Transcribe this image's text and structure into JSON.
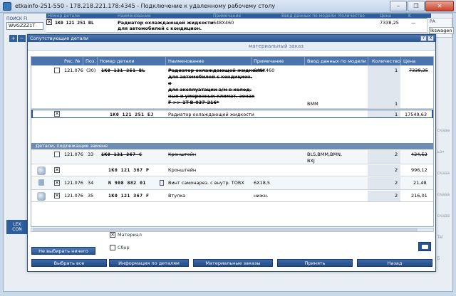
{
  "window": {
    "title": "etkainfo-251-550 - 178.218.221.178:4345 - Подключение к удаленному рабочему столу",
    "buttons": {
      "minimize": "–",
      "restore": "❐",
      "close": "✕"
    }
  },
  "background": {
    "search_label": "ПОИСК FI",
    "search_value": "WVGZZZ1T",
    "header_cols": [
      "Номер детали",
      "Наименование",
      "Примечание",
      "Ввод данных по модели",
      "Количество",
      "Цена",
      "K"
    ],
    "row": {
      "part": "1K0 121 251 BL",
      "name": "Радиатор охлаждающей жидкости",
      "name2": "для автомобилей с кондицион.",
      "note": "648X460",
      "price": "7338,25",
      "k": "—"
    },
    "right_tab_label": "РА",
    "right_tab_value": "lkswagen",
    "left_strip": "LEX\nCON",
    "right_labels": [
      "сказа",
      "ьз»",
      "сказа",
      "сказа",
      "сказа",
      "Tal",
      "Б"
    ]
  },
  "dialog": {
    "title": "Сопутствующие детали",
    "title_btns": [
      "?",
      "X"
    ],
    "subtitle": "материальный заказ",
    "columns": [
      "Рис. №",
      "Поз.",
      "Номер детали",
      "Наименование",
      "Примечание",
      "Ввод данных по модели",
      "Количество",
      "Цена"
    ],
    "rows": [
      {
        "checked": false,
        "fig": "121.076",
        "pos": "(30)",
        "part": "1K0 121 251 BL",
        "name_lines": [
          "Радиатор охлаждающей жидкости",
          "для автомобилей с кондицион.",
          "и",
          "для эксплуатации а/м в холод.",
          "ных и умеренных климат. зонах",
          "F          >> 1T-B-037-216*"
        ],
        "note": "648X460",
        "model": "BMM",
        "qty": "1",
        "qty2": "1",
        "price": "7338,25"
      },
      {
        "checked": true,
        "part": "1K0 121 251 EJ",
        "name": "Радиатор охлаждающей жидкости",
        "qty": "1",
        "price": "17549,63"
      }
    ],
    "section": "Детали, подлежащие замене",
    "replace_rows": [
      {
        "checked": false,
        "fig": "121.076",
        "pos": "33",
        "part": "1K0 121 367 C",
        "name": "Кронштейн",
        "model": "BLS,BMM,BMN,",
        "model2": "BXJ",
        "qty": "2",
        "price": "424,52"
      },
      {
        "checked": true,
        "part": "1K0 121 367 P",
        "name": "Кронштейн",
        "qty": "2",
        "price": "996,12"
      },
      {
        "checked": true,
        "fig": "121.076",
        "pos": "34",
        "part": "N    908 882 01",
        "name": "Винт самонарез. с внутр. TORX",
        "note": "6X18,5",
        "qty": "2",
        "price": "21,48"
      },
      {
        "checked": true,
        "fig": "121.076",
        "pos": "35",
        "part": "1K0 121 367 F",
        "name": "Втулка",
        "note": "нижн.",
        "qty": "2",
        "price": "216,01"
      }
    ],
    "controls": {
      "material_label": "Материал",
      "material_checked": true,
      "assembly_label": "Сбор",
      "assembly_checked": false,
      "deselect_all": "Не выбирать ничего",
      "select_all": "Выбрать все",
      "part_info": "Информация по деталям",
      "material_orders": "Материальные заказы",
      "accept": "Принять",
      "back": "Назад"
    }
  }
}
